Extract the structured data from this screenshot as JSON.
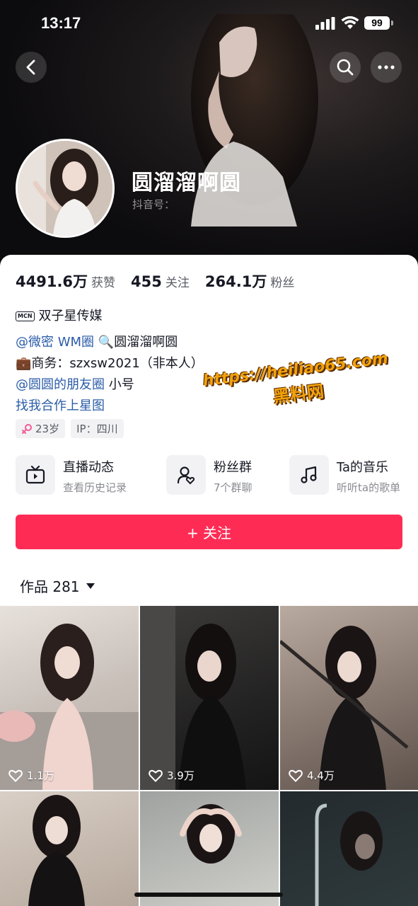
{
  "status_bar": {
    "time": "13:17",
    "battery": "99"
  },
  "profile": {
    "nickname": "圆溜溜啊圆",
    "douyin_id_label": "抖音号：",
    "stats": [
      {
        "value": "4491.6万",
        "label": "获赞"
      },
      {
        "value": "455",
        "label": "关注"
      },
      {
        "value": "264.1万",
        "label": "粉丝"
      }
    ],
    "mcn": {
      "badge": "MCN",
      "name": "双子星传媒"
    },
    "bio": {
      "line1_link": "@微密 WM圈",
      "line1_text": "🔍圆溜溜啊圆",
      "line2_text": "💼商务：szxsw2021（非本人）",
      "line3_link": "@圆圆的朋友圈",
      "line3_text": " 小号",
      "line4_link": "找我合作上星图"
    },
    "tags": [
      {
        "icon": "female-symbol-icon",
        "text": "23岁"
      },
      {
        "text": "IP：四川"
      }
    ]
  },
  "feature_cards": [
    {
      "icon": "tv-icon",
      "title": "直播动态",
      "subtitle": "查看历史记录"
    },
    {
      "icon": "fan-group-icon",
      "title": "粉丝群",
      "subtitle": "7个群聊"
    },
    {
      "icon": "music-note-icon",
      "title": "Ta的音乐",
      "subtitle": "听听ta的歌单"
    }
  ],
  "follow_button": {
    "label": "+ 关注"
  },
  "works_tab": {
    "label": "作品 281"
  },
  "videos": [
    {
      "likes": "1.1万"
    },
    {
      "likes": "3.9万"
    },
    {
      "likes": "4.4万"
    },
    {
      "likes": ""
    },
    {
      "likes": ""
    },
    {
      "likes": ""
    }
  ],
  "watermark": {
    "url": "https://heiliao65.com",
    "name": "黑料网"
  },
  "colors": {
    "accent": "#fe2c55",
    "link": "#2b5ca8",
    "watermark": "#f2a20c"
  }
}
